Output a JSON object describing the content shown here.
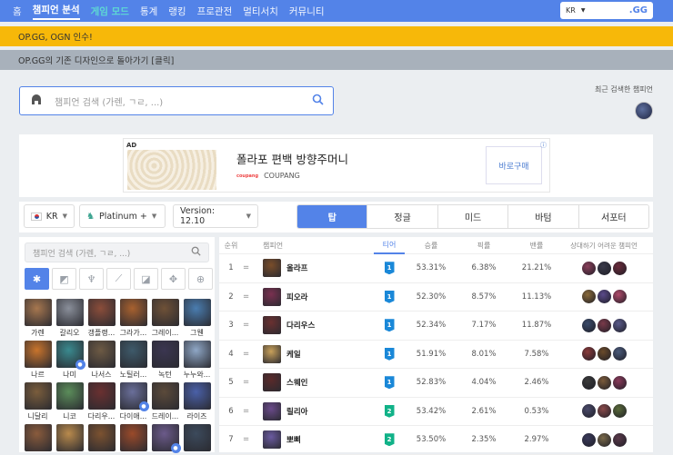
{
  "nav": {
    "items": [
      "홈",
      "챔피언 분석",
      "게임 모드",
      "통계",
      "랭킹",
      "프로관전",
      "멀티서치",
      "커뮤니티"
    ],
    "active_index": 1,
    "highlight_index": 2,
    "region": "KR",
    "logo_text": ".GG"
  },
  "notices": [
    "OP.GG, OGN 인수!",
    "OP.GG의 기존 디자인으로 돌아가기 [클릭]"
  ],
  "search": {
    "placeholder": "챔피언 검색 (가렌, ㄱㄹ, ...)"
  },
  "recent": {
    "label": "최근 검색한 챔피언"
  },
  "ad": {
    "tag": "AD",
    "title": "폴라포 편백 방향주머니",
    "brand": "COUPANG",
    "brand_logo": "coupang",
    "button": "바로구매",
    "info": "ⓘ"
  },
  "filters": {
    "region": "KR",
    "tier": "Platinum +",
    "version": "Version: 12.10"
  },
  "positions": [
    "탑",
    "정글",
    "미드",
    "바텀",
    "서포터"
  ],
  "active_position": 0,
  "left": {
    "search_placeholder": "챔피언 검색 (가렌, ㄱㄹ, ...)",
    "roles": [
      "all-icon",
      "top-icon",
      "jungle-icon",
      "mid-icon",
      "bottom-icon",
      "support-icon",
      "lock-icon"
    ],
    "champions": [
      {
        "name": "가렌",
        "color": "#a7774f"
      },
      {
        "name": "갈리오",
        "color": "#8a8f9a"
      },
      {
        "name": "갱플랭...",
        "color": "#8b4d3a"
      },
      {
        "name": "그라가...",
        "color": "#a8612f"
      },
      {
        "name": "그레이...",
        "color": "#6f5137"
      },
      {
        "name": "그웬",
        "color": "#4a7db0"
      },
      {
        "name": "나르",
        "color": "#c9742c"
      },
      {
        "name": "나미",
        "color": "#3a8a8f",
        "lock": true
      },
      {
        "name": "나서스",
        "color": "#6d5a44"
      },
      {
        "name": "노틸러...",
        "color": "#3e5a6a"
      },
      {
        "name": "녹턴",
        "color": "#3b3651"
      },
      {
        "name": "누누와...",
        "color": "#8fa7c6"
      },
      {
        "name": "니달리",
        "color": "#7a5d3c"
      },
      {
        "name": "니코",
        "color": "#5b8d5a"
      },
      {
        "name": "다리우...",
        "color": "#6a3030"
      },
      {
        "name": "다이애...",
        "color": "#6a6f9a",
        "lock": true
      },
      {
        "name": "드레이...",
        "color": "#5b4a3a"
      },
      {
        "name": "라이즈",
        "color": "#4a60a8"
      },
      {
        "name": "",
        "color": "#8a5b3c"
      },
      {
        "name": "",
        "color": "#b98a4c"
      },
      {
        "name": "",
        "color": "#7c5230"
      },
      {
        "name": "",
        "color": "#9a4a2a"
      },
      {
        "name": "",
        "color": "#6b5a8a",
        "lock": true
      },
      {
        "name": "",
        "color": "#3c4a5c"
      }
    ]
  },
  "table": {
    "headers": [
      "순위",
      "챔피언",
      "티어",
      "승률",
      "픽률",
      "밴률",
      "상대하기 어려운 챔피언"
    ],
    "rows": [
      {
        "rank": "1",
        "trend": "=",
        "name": "올라프",
        "tier": "1",
        "win": "53.31%",
        "pick": "6.38%",
        "ban": "21.21%",
        "color": "#7a4d2a",
        "counters": [
          "#8a3f5a",
          "#3a3a4a",
          "#6a2a3a"
        ]
      },
      {
        "rank": "2",
        "trend": "=",
        "name": "피오라",
        "tier": "1",
        "win": "52.30%",
        "pick": "8.57%",
        "ban": "11.13%",
        "color": "#7a3050",
        "counters": [
          "#8a6a3a",
          "#5a4a8a",
          "#b04a6a"
        ]
      },
      {
        "rank": "3",
        "trend": "=",
        "name": "다리우스",
        "tier": "1",
        "win": "52.34%",
        "pick": "7.17%",
        "ban": "11.87%",
        "color": "#6a3030",
        "counters": [
          "#3a4a6a",
          "#7a3a4a",
          "#5a5a8a"
        ]
      },
      {
        "rank": "4",
        "trend": "=",
        "name": "케일",
        "tier": "1",
        "win": "51.91%",
        "pick": "8.01%",
        "ban": "7.58%",
        "color": "#c8a05a",
        "counters": [
          "#8a3a3a",
          "#6a4a2a",
          "#4a5a7a"
        ]
      },
      {
        "rank": "5",
        "trend": "=",
        "name": "스웨인",
        "tier": "1",
        "win": "52.83%",
        "pick": "4.04%",
        "ban": "2.46%",
        "color": "#5a2a2a",
        "counters": [
          "#3a3a3a",
          "#7a5a3a",
          "#8a3a5a"
        ]
      },
      {
        "rank": "6",
        "trend": "=",
        "name": "릴리아",
        "tier": "2",
        "win": "53.42%",
        "pick": "2.61%",
        "ban": "0.53%",
        "color": "#6a4a8a",
        "counters": [
          "#4a4a6a",
          "#8a4a4a",
          "#5a6a3a"
        ]
      },
      {
        "rank": "7",
        "trend": "=",
        "name": "뽀삐",
        "tier": "2",
        "win": "53.50%",
        "pick": "2.35%",
        "ban": "2.97%",
        "color": "#6a5aa0",
        "counters": [
          "#3a3a5a",
          "#7a6a4a",
          "#5a3a4a"
        ]
      }
    ]
  }
}
